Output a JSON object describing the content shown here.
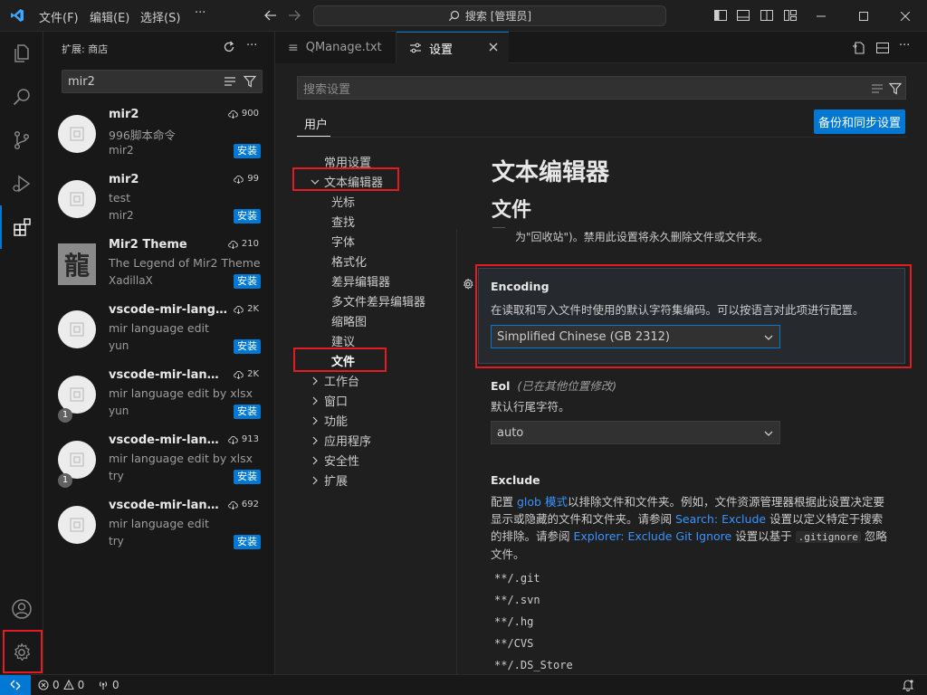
{
  "titlebar": {
    "menus": [
      "文件(F)",
      "编辑(E)",
      "选择(S)"
    ],
    "more": "···",
    "search": "搜索 [管理员]"
  },
  "sidebar": {
    "title": "扩展: 商店",
    "search_value": "mir2",
    "extensions": [
      {
        "name": "mir2",
        "desc": "996脚本命令",
        "author": "mir2",
        "downloads": "900",
        "install": "安装",
        "icon": "placeholder-icon"
      },
      {
        "name": "mir2",
        "desc": "test",
        "author": "mir2",
        "downloads": "99",
        "install": "安装",
        "icon": "placeholder-icon"
      },
      {
        "name": "Mir2 Theme",
        "desc": "The Legend of Mir2 Theme",
        "author": "XadillaX",
        "downloads": "210",
        "install": "安装",
        "icon": "mir2-theme-logo"
      },
      {
        "name": "vscode-mir-language",
        "desc": "mir language edit",
        "author": "yun",
        "downloads": "2K",
        "install": "安装",
        "icon": "placeholder-icon"
      },
      {
        "name": "vscode-mir-langua...",
        "desc": "mir language edit by xlsx",
        "author": "yun",
        "downloads": "2K",
        "install": "安装",
        "badge": "1",
        "icon": "placeholder-icon"
      },
      {
        "name": "vscode-mir-langua...",
        "desc": "mir language edit by xlsx",
        "author": "try",
        "downloads": "913",
        "install": "安装",
        "badge": "1",
        "icon": "placeholder-icon"
      },
      {
        "name": "vscode-mir-langua...",
        "desc": "mir language edit",
        "author": "try",
        "downloads": "692",
        "install": "安装",
        "icon": "placeholder-icon"
      }
    ]
  },
  "tabs": [
    {
      "label": "QManage.txt",
      "active": false
    },
    {
      "label": "设置",
      "active": true
    }
  ],
  "settings": {
    "search_placeholder": "搜索设置",
    "scope_tab": "用户",
    "backup_button": "备份和同步设置",
    "toc": {
      "common": "常用设置",
      "text_editor": "文本编辑器",
      "text_editor_children": [
        "光标",
        "查找",
        "字体",
        "格式化",
        "差异编辑器",
        "多文件差异编辑器",
        "缩略图",
        "建议",
        "文件"
      ],
      "others": [
        "工作台",
        "窗口",
        "功能",
        "应用程序",
        "安全性",
        "扩展"
      ]
    },
    "heading_section": "文本编辑器",
    "heading_sub": "文件",
    "trash_desc": "为\"回收站\")。禁用此设置将永久删除文件或文件夹。",
    "encoding": {
      "title": "Encoding",
      "desc": "在读取和写入文件时使用的默认字符集编码。可以按语言对此项进行配置。",
      "value": "Simplified Chinese (GB 2312)"
    },
    "eol": {
      "title": "Eol",
      "modified_note": "(已在其他位置修改)",
      "desc": "默认行尾字符。",
      "value": "auto"
    },
    "exclude": {
      "title": "Exclude",
      "desc_1": "配置 ",
      "link_glob": "glob 模式",
      "desc_2": "以排除文件和文件夹。例如，文件资源管理器根据此设置决定要显示或隐藏的文件和文件夹。请参阅 ",
      "link_search": "Search: Exclude",
      "desc_3": " 设置以定义特定于搜索的排除。请参阅 ",
      "link_explorer": "Explorer: Exclude Git Ignore",
      "desc_4": " 设置以基于 ",
      "code": ".gitignore",
      "desc_5": " 忽略文件。",
      "patterns": [
        "**/.git",
        "**/.svn",
        "**/.hg",
        "**/CVS",
        "**/.DS_Store"
      ]
    }
  },
  "statusbar": {
    "errors": "0",
    "warnings": "0",
    "ports": "0"
  },
  "colors": {
    "accent": "#0078d4",
    "highlight": "#e51b24",
    "link": "#3794ff"
  }
}
